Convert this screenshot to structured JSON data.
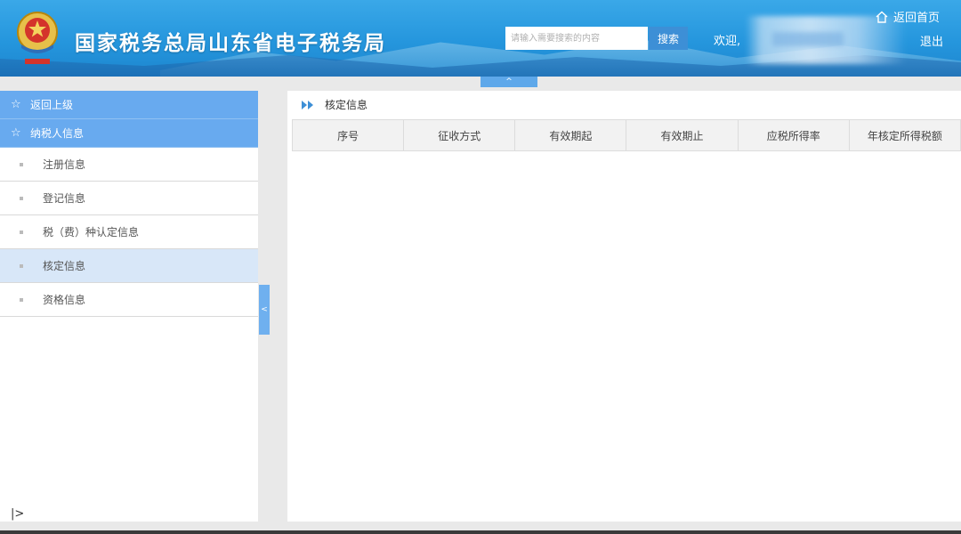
{
  "header": {
    "site_title": "国家税务总局山东省电子税务局",
    "search_placeholder": "请输入需要搜索的内容",
    "search_button": "搜索",
    "welcome": "欢迎,",
    "home_link": "返回首页",
    "logout": "退出",
    "collapse_arrow": "^",
    "accent_color": "#2596dd"
  },
  "sidebar": {
    "heads": [
      {
        "label": "返回上级"
      },
      {
        "label": "纳税人信息"
      }
    ],
    "items": [
      {
        "label": "注册信息"
      },
      {
        "label": "登记信息"
      },
      {
        "label": "税（费）种认定信息"
      },
      {
        "label": "核定信息",
        "active": true
      },
      {
        "label": "资格信息"
      }
    ],
    "toggle_symbol": "<",
    "bottom_symbol": "|>"
  },
  "main": {
    "title": "核定信息",
    "columns": [
      "序号",
      "征收方式",
      "有效期起",
      "有效期止",
      "应税所得率",
      "年核定所得税额"
    ]
  }
}
